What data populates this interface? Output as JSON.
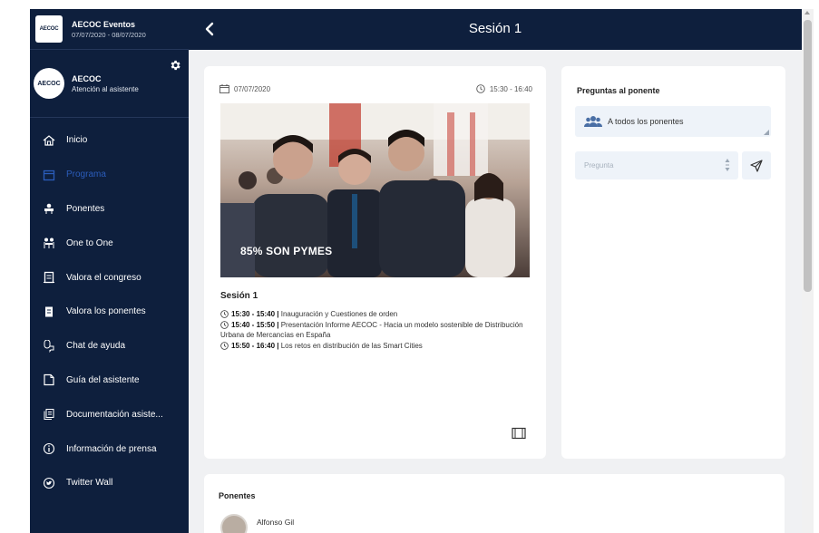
{
  "app": {
    "logo_text": "AECOC",
    "name": "AECOC Eventos",
    "dates": "07/07/2020 - 08/07/2020"
  },
  "user": {
    "logo_text": "AECOC",
    "name": "AECOC",
    "role": "Atención al asistente"
  },
  "menu": [
    {
      "label": "Inicio",
      "icon": "home-icon",
      "active": false
    },
    {
      "label": "Programa",
      "icon": "calendar-icon",
      "active": true
    },
    {
      "label": "Ponentes",
      "icon": "speakers-icon",
      "active": false
    },
    {
      "label": "One to One",
      "icon": "meeting-icon",
      "active": false
    },
    {
      "label": "Valora el congreso",
      "icon": "rate-congress-icon",
      "active": false
    },
    {
      "label": "Valora los ponentes",
      "icon": "rate-speakers-icon",
      "active": false
    },
    {
      "label": "Chat de ayuda",
      "icon": "chat-icon",
      "active": false
    },
    {
      "label": "Guía del asistente",
      "icon": "guide-icon",
      "active": false
    },
    {
      "label": "Documentación asiste...",
      "icon": "documents-icon",
      "active": false
    },
    {
      "label": "Información de prensa",
      "icon": "info-icon",
      "active": false
    },
    {
      "label": "Twitter Wall",
      "icon": "twitter-icon",
      "active": false
    }
  ],
  "header": {
    "title": "Sesión 1"
  },
  "session": {
    "date": "07/07/2020",
    "time": "15:30 - 16:40",
    "photo_caption": "85% SON PYMES",
    "title": "Sesión 1",
    "agenda": [
      {
        "time": "15:30 - 15:40 |",
        "text": " Inauguración y Cuestiones de orden"
      },
      {
        "time": "15:40 - 15:50 |",
        "text": " Presentación Informe AECOC - Hacia un modelo sostenible de Distribución Urbana de Mercancías en España"
      },
      {
        "time": "15:50 - 16:40 |",
        "text": " Los retos en distribución de las Smart Cities"
      }
    ]
  },
  "questions": {
    "title": "Preguntas al ponente",
    "recipient": "A todos los ponentes",
    "placeholder": "Pregunta"
  },
  "ponentes": {
    "title": "Ponentes",
    "speakers": [
      {
        "name": "Alfonso Gil"
      }
    ]
  },
  "colors": {
    "navy": "#0e1f3d",
    "active": "#2b5dbb",
    "content_bg": "#f0f1f3",
    "input_bg": "#eef3f9"
  }
}
